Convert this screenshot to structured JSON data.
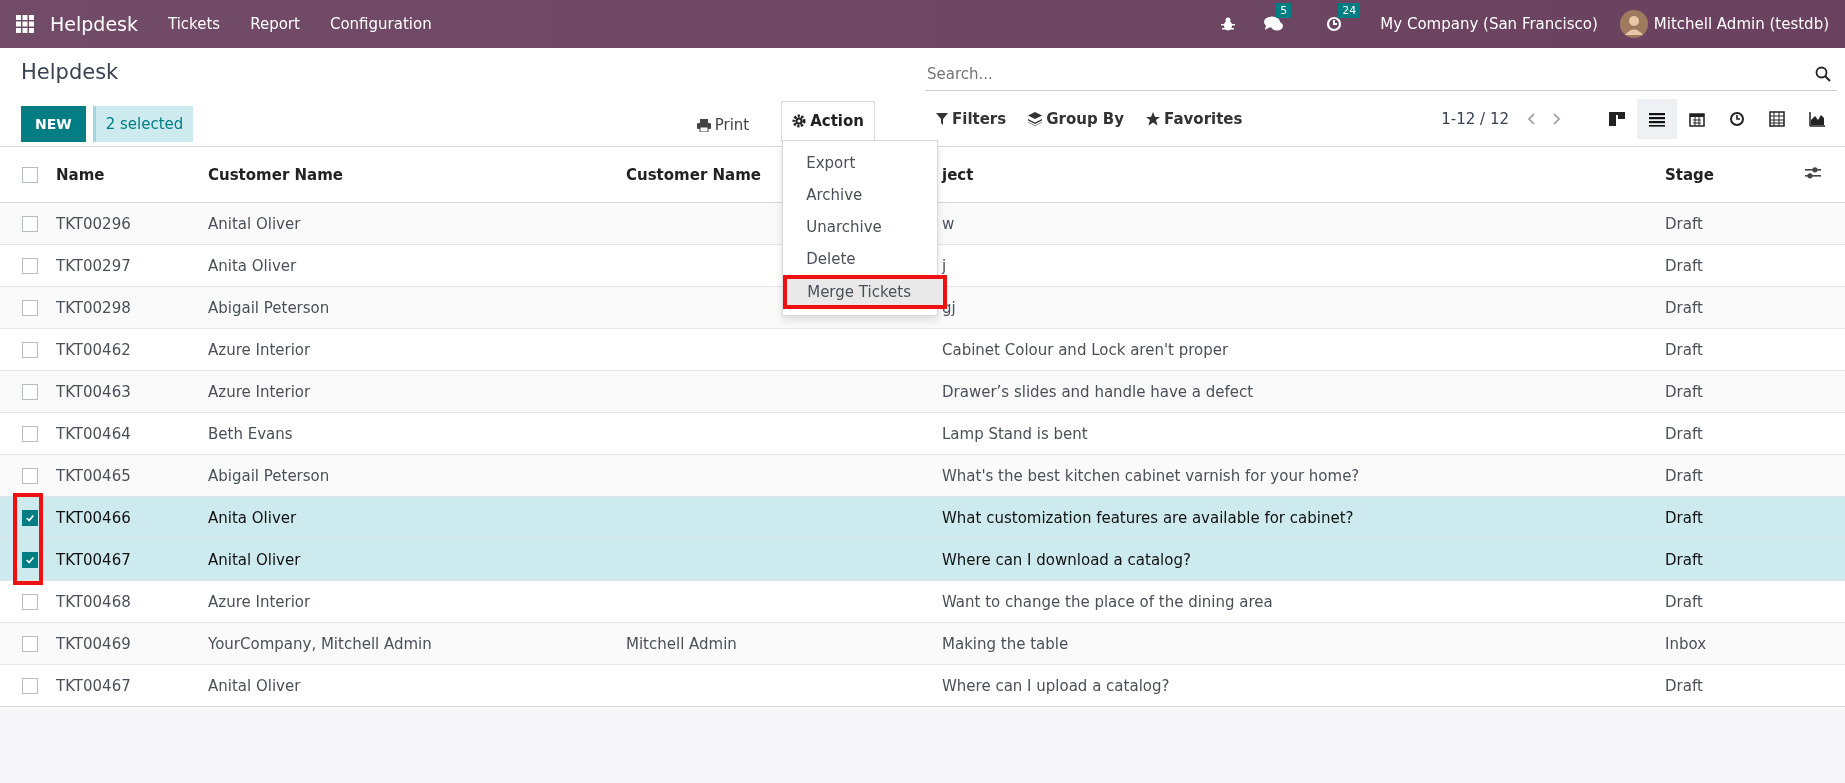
{
  "navbar": {
    "app_name": "Helpdesk",
    "menus": [
      "Tickets",
      "Report",
      "Configuration"
    ],
    "messages_count": "5",
    "activities_count": "24",
    "company": "My Company (San Francisco)",
    "user": "Mitchell Admin (testdb)"
  },
  "control_panel": {
    "title": "Helpdesk",
    "new_button": "NEW",
    "selection": "2 selected",
    "print": "Print",
    "action": "Action",
    "search": {
      "placeholder": "Search..."
    },
    "filters": "Filters",
    "group_by": "Group By",
    "favorites": "Favorites",
    "pager": "1-12 / 12",
    "views": [
      {
        "kind": "kanban",
        "selected": false
      },
      {
        "kind": "list",
        "selected": true
      },
      {
        "kind": "calendar",
        "selected": false
      },
      {
        "kind": "activity",
        "selected": false
      },
      {
        "kind": "pivot",
        "selected": false
      },
      {
        "kind": "graph",
        "selected": false
      }
    ]
  },
  "action_menu": {
    "items": [
      {
        "label": "Export",
        "highlighted": false
      },
      {
        "label": "Archive",
        "highlighted": false
      },
      {
        "label": "Unarchive",
        "highlighted": false
      },
      {
        "label": "Delete",
        "highlighted": false
      },
      {
        "label": "Merge Tickets",
        "highlighted": true
      }
    ]
  },
  "table": {
    "select_all_checked": false,
    "checkbox_highlight": true,
    "columns": [
      "Name",
      "Customer Name",
      "Customer Name",
      "ject",
      "Stage"
    ],
    "rows": [
      {
        "selected": false,
        "cells": [
          "TKT00296",
          "Anital Oliver",
          "",
          "w",
          "Draft"
        ]
      },
      {
        "selected": false,
        "cells": [
          "TKT00297",
          "Anita Oliver",
          "",
          "j",
          "Draft"
        ]
      },
      {
        "selected": false,
        "cells": [
          "TKT00298",
          "Abigail Peterson",
          "",
          "gj",
          "Draft"
        ]
      },
      {
        "selected": false,
        "cells": [
          "TKT00462",
          "Azure Interior",
          "",
          "Cabinet Colour and Lock aren't proper",
          "Draft"
        ]
      },
      {
        "selected": false,
        "cells": [
          "TKT00463",
          "Azure Interior",
          "",
          "Drawer’s slides and handle have a defect",
          "Draft"
        ]
      },
      {
        "selected": false,
        "cells": [
          "TKT00464",
          "Beth Evans",
          "",
          "Lamp Stand is bent",
          "Draft"
        ]
      },
      {
        "selected": false,
        "cells": [
          "TKT00465",
          "Abigail Peterson",
          "",
          "What's the best kitchen cabinet varnish for your home?",
          "Draft"
        ]
      },
      {
        "selected": true,
        "cells": [
          "TKT00466",
          "Anita Oliver",
          "",
          "What customization features are available for cabinet?",
          "Draft"
        ]
      },
      {
        "selected": true,
        "cells": [
          "TKT00467",
          "Anital Oliver",
          "",
          "Where can I download a catalog?",
          "Draft"
        ]
      },
      {
        "selected": false,
        "cells": [
          "TKT00468",
          "Azure Interior",
          "",
          "Want to change the place of the dining area",
          "Draft"
        ]
      },
      {
        "selected": false,
        "cells": [
          "TKT00469",
          "YourCompany, Mitchell Admin",
          "Mitchell Admin",
          "Making the table",
          "Inbox"
        ]
      },
      {
        "selected": false,
        "cells": [
          "TKT00467",
          "Anital Oliver",
          "",
          "Where can I upload a catalog?",
          "Draft"
        ]
      }
    ]
  }
}
